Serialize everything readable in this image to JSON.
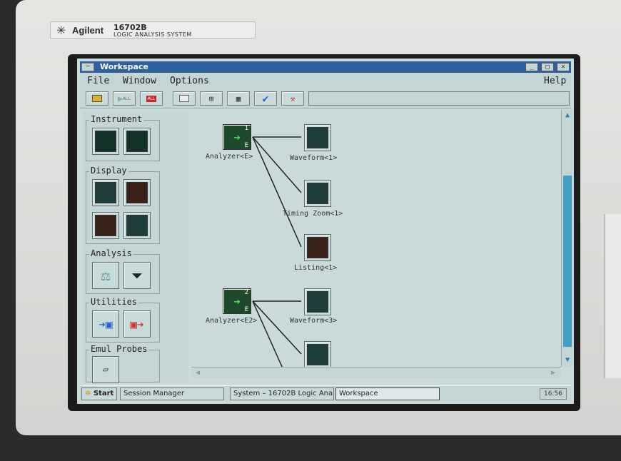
{
  "device": {
    "brand": "Agilent",
    "model": "16702B",
    "subtitle": "LOGIC ANALYSIS SYSTEM"
  },
  "window": {
    "title": "Workspace",
    "sysmenu": "–",
    "min": "_",
    "max": "□",
    "close": "×"
  },
  "menu": {
    "file": "File",
    "window": "Window",
    "options": "Options",
    "help": "Help"
  },
  "toolbar": {
    "run_all": "ALL",
    "stop_all": "ALL"
  },
  "sidebar": {
    "instrument": "Instrument",
    "display": "Display",
    "analysis": "Analysis",
    "utilities": "Utilities",
    "emul_probes": "Emul Probes"
  },
  "nodes": {
    "analyzer1": "Analyzer<E>",
    "analyzer1_num": "1",
    "analyzer1_letter": "E",
    "waveform1": "Waveform<1>",
    "timing_zoom1": "Timing Zoom<1>",
    "listing1": "Listing<1>",
    "analyzer2": "Analyzer<E2>",
    "analyzer2_num": "2",
    "analyzer2_letter": "E",
    "waveform3": "Waveform<3>"
  },
  "taskbar": {
    "start": "Start",
    "session_manager": "Session Manager",
    "system": "System – 16702B Logic Ana...",
    "workspace": "Workspace",
    "clock": "16:56"
  },
  "colors": {
    "accent": "#2f5f9c",
    "background": "#c9dadb",
    "scroll": "#3fa0c4"
  }
}
